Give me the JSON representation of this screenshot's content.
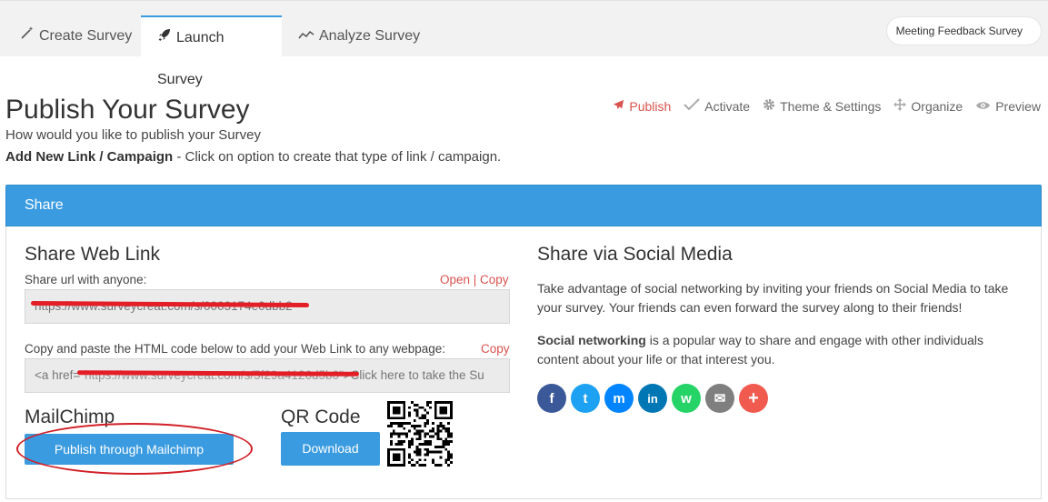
{
  "tabs": [
    {
      "label": "Create Survey",
      "icon": "magic-wand-icon",
      "active": false
    },
    {
      "label": "Launch Survey",
      "icon": "rocket-icon",
      "active": true
    },
    {
      "label": "Analyze Survey",
      "icon": "line-chart-icon",
      "active": false
    }
  ],
  "survey_selector": {
    "value": "Meeting Feedback Survey"
  },
  "header": {
    "title": "Publish Your Survey",
    "subtitle": "How would you like to publish your Survey",
    "add_new_bold": "Add New Link / Campaign",
    "add_new_rest": " - Click on option to create that type of link / campaign."
  },
  "steps": [
    {
      "label": "Publish",
      "icon": "paper-plane-icon",
      "active": true
    },
    {
      "label": "Activate",
      "icon": "check-icon",
      "active": false
    },
    {
      "label": "Theme & Settings",
      "icon": "gear-icon",
      "active": false
    },
    {
      "label": "Organize",
      "icon": "move-arrows-icon",
      "active": false
    },
    {
      "label": "Preview",
      "icon": "eye-icon",
      "active": false
    }
  ],
  "panel": {
    "title": "Share"
  },
  "web_link": {
    "heading": "Share Web Link",
    "url_label": "Share url with anyone:",
    "open_label": "Open",
    "copy_label": "Copy",
    "url_value": "https://www.surveycreat.com/s/0003174e0dbb2",
    "html_label": "Copy and paste the HTML code below to add your Web Link to any webpage:",
    "html_copy_label": "Copy",
    "html_prefix": "<a href=",
    "html_hidden": "\"https://www.surveycreat.com/s/5f29a4126d5b0\"",
    "html_suffix": ">Click here to take the Su"
  },
  "mailchimp": {
    "heading": "MailChimp",
    "button_label": "Publish through Mailchimp"
  },
  "qr": {
    "heading": "QR Code",
    "button_label": "Download"
  },
  "social": {
    "heading": "Share via Social Media",
    "paragraph1": "Take advantage of social networking by inviting your friends on Social Media to take your survey. Your friends can even forward the survey along to their friends!",
    "paragraph2_bold": "Social networking",
    "paragraph2_rest": " is a popular way to share and engage with other individuals content about your life or that interest you.",
    "icons": [
      {
        "name": "facebook-icon",
        "glyph": "f",
        "color": "#3b5998"
      },
      {
        "name": "twitter-icon",
        "glyph": "t",
        "color": "#1da1f2"
      },
      {
        "name": "messenger-icon",
        "glyph": "m",
        "color": "#0084ff"
      },
      {
        "name": "linkedin-icon",
        "glyph": "in",
        "color": "#0077b5"
      },
      {
        "name": "whatsapp-icon",
        "glyph": "w",
        "color": "#25d366"
      },
      {
        "name": "email-icon",
        "glyph": "✉",
        "color": "#7f7f7f"
      },
      {
        "name": "more-icon",
        "glyph": "+",
        "color": "#f05a4f"
      }
    ]
  },
  "colors": {
    "accent": "#3a9be0",
    "danger": "#d9534f",
    "annotation_red": "#e41e26"
  }
}
